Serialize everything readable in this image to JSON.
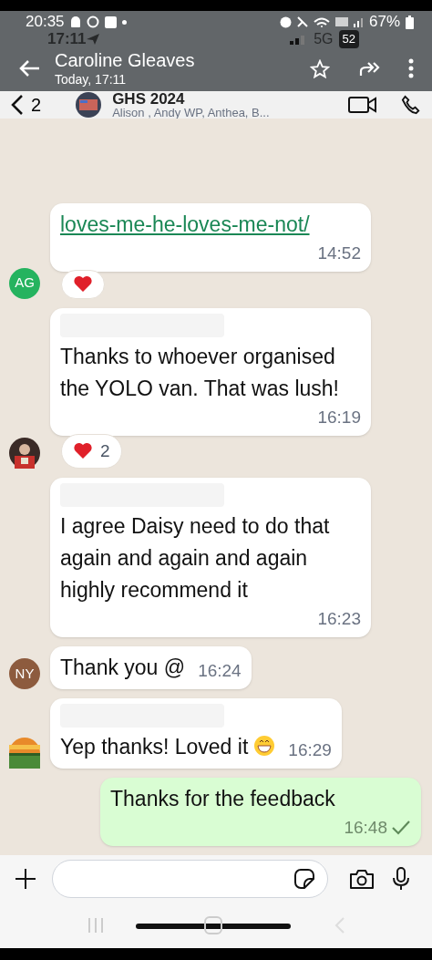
{
  "status_bar": {
    "time": "20:35",
    "battery": "67%"
  },
  "underlay_status": {
    "time": "17:11",
    "network": "5G",
    "badge": "52"
  },
  "viewer": {
    "title": "Caroline Gleaves",
    "subtitle": "Today, 17:11"
  },
  "chat_header": {
    "back_count": "2",
    "title": "GHS 2024",
    "members": "Alison , Andy WP, Anthea, B..."
  },
  "messages": [
    {
      "kind": "incoming",
      "avatar": {
        "kind": "initials",
        "initials": "AG",
        "color": "#25b35f"
      },
      "sender_hidden": false,
      "link": true,
      "text": "loves-me-he-loves-me-not/",
      "time": "14:52",
      "reaction": true
    },
    {
      "kind": "incoming",
      "sender_hidden": true,
      "link": false,
      "text": "Thanks to whoever organised the YOLO van. That was lush!",
      "time": "16:19",
      "reaction": true,
      "reaction_count": "2"
    },
    {
      "kind": "incoming",
      "sender_hidden": true,
      "link": false,
      "text": "I agree Daisy need to do that again and again and again highly recommend it",
      "time": "16:23",
      "reaction": false
    },
    {
      "kind": "incoming",
      "avatar": {
        "kind": "initials",
        "initials": "NY",
        "color": "#8d5b3e"
      },
      "sender_hidden": false,
      "link": false,
      "text": "Thank you @",
      "time": "16:24",
      "reaction": false
    },
    {
      "kind": "incoming",
      "sender_hidden": true,
      "link": false,
      "text": "Yep thanks! Loved it",
      "grin_emoji": true,
      "time": "16:29",
      "reaction": false
    },
    {
      "kind": "outgoing",
      "text": "Thanks for the feedback",
      "time": "16:48",
      "sent": true
    }
  ]
}
